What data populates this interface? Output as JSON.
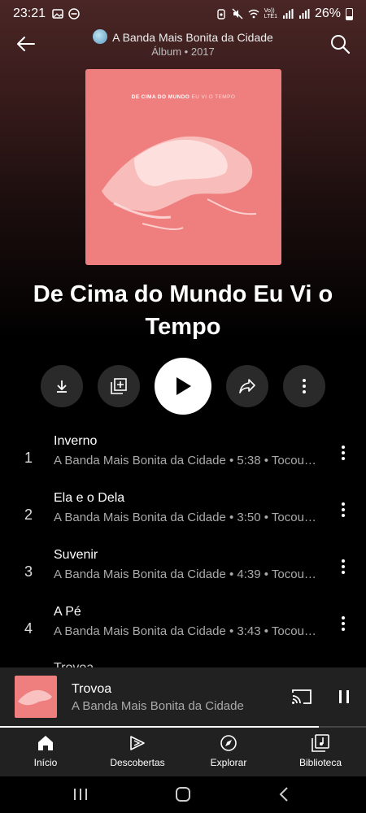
{
  "status_bar": {
    "time": "23:21",
    "battery": "26%",
    "volte": "Vo))",
    "lte": "LTE1"
  },
  "header": {
    "title": "A Banda Mais Bonita da Cidade",
    "subtitle": "Álbum • 2017"
  },
  "cover": {
    "artist_text": "DE CIMA DO MUNDO",
    "title_text": "EU VI O TEMPO",
    "background_color": "#ef7e7e"
  },
  "album": {
    "title": "De Cima do Mundo Eu Vi o Tempo"
  },
  "actions": {
    "download": "download-icon",
    "save": "add-to-library-icon",
    "play": "play-icon",
    "share": "share-icon",
    "more": "more-vertical-icon"
  },
  "tracks": [
    {
      "num": "1",
      "name": "Inverno",
      "meta": "A Banda Mais Bonita da Cidade • 5:38 • Tocou…"
    },
    {
      "num": "2",
      "name": "Ela e o Dela",
      "meta": "A Banda Mais Bonita da Cidade • 3:50 • Tocou…"
    },
    {
      "num": "3",
      "name": "Suvenir",
      "meta": "A Banda Mais Bonita da Cidade • 4:39 • Tocou…"
    },
    {
      "num": "4",
      "name": "A Pé",
      "meta": "A Banda Mais Bonita da Cidade • 3:43 • Tocou…"
    }
  ],
  "partial_track": "Trovoa",
  "mini_player": {
    "title": "Trovoa",
    "artist": "A Banda Mais Bonita da Cidade",
    "progress": 0.87
  },
  "nav": {
    "home": "Início",
    "explore_new": "Descobertas",
    "explore": "Explorar",
    "library": "Biblioteca"
  },
  "accent_color": "#ffffff"
}
